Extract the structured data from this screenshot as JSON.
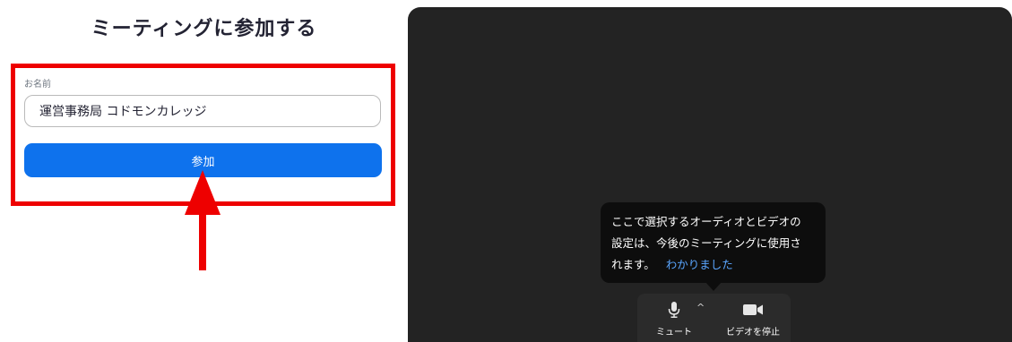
{
  "join": {
    "title": "ミーティングに参加する",
    "name_label": "お名前",
    "name_value": "運営事務局 コドモンカレッジ",
    "join_button": "参加"
  },
  "tooltip": {
    "message_line1": "ここで選択するオーディオとビデオの",
    "message_line2": "設定は、今後のミーティングに使用さ",
    "message_line3": "れます。",
    "link": "わかりました"
  },
  "controls": {
    "mute_label": "ミュート",
    "video_label": "ビデオを停止",
    "mic_icon": "microphone-icon",
    "caret_icon": "chevron-up-icon",
    "camera_icon": "video-camera-icon"
  },
  "colors": {
    "accent": "#0e72ed",
    "highlight": "#ee0000",
    "preview_bg": "#232323",
    "link": "#5aa6ff"
  }
}
